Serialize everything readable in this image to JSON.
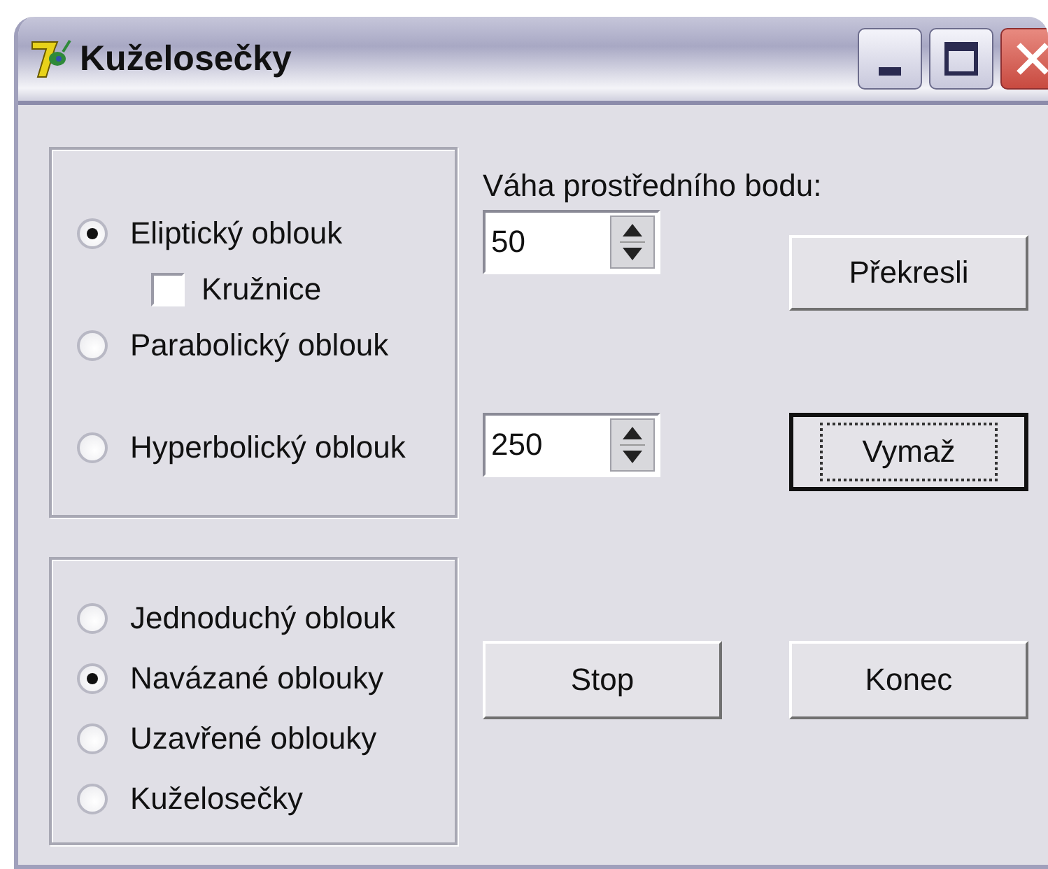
{
  "window": {
    "title": "Kuželosečky"
  },
  "curve_group": {
    "items": [
      {
        "kind": "radio",
        "label": "Eliptický oblouk",
        "selected": true
      },
      {
        "kind": "checkbox",
        "label": "Kružnice",
        "checked": false
      },
      {
        "kind": "radio",
        "label": "Parabolický oblouk",
        "selected": false
      },
      {
        "kind": "radio",
        "label": "Hyperbolický oblouk",
        "selected": false
      }
    ]
  },
  "mode_group": {
    "items": [
      {
        "kind": "radio",
        "label": "Jednoduchý oblouk",
        "selected": false
      },
      {
        "kind": "radio",
        "label": "Navázané oblouky",
        "selected": true
      },
      {
        "kind": "radio",
        "label": "Uzavřené oblouky",
        "selected": false
      },
      {
        "kind": "radio",
        "label": "Kuželosečky",
        "selected": false
      }
    ]
  },
  "weight_label": "Váha prostředního bodu:",
  "weight_spin": {
    "value": "50"
  },
  "second_spin": {
    "value": "250"
  },
  "redraw_button": {
    "label": "Překresli",
    "default": false
  },
  "clear_button": {
    "label": "Vymaž",
    "default": true
  },
  "stop_button": {
    "label": "Stop",
    "default": false
  },
  "end_button": {
    "label": "Konec",
    "default": false
  }
}
